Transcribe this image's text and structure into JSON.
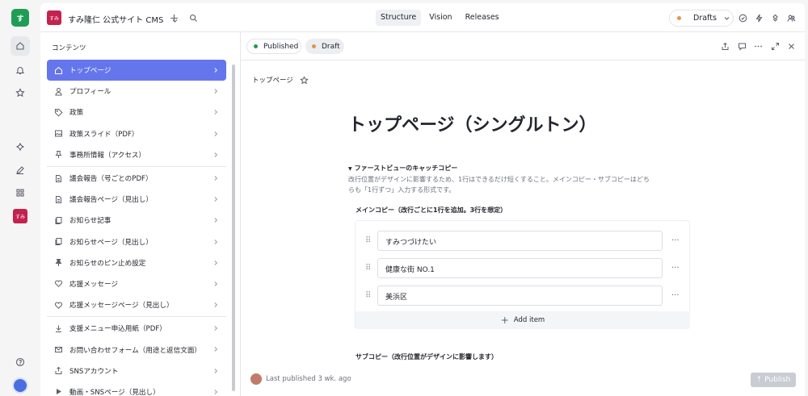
{
  "rail": {
    "logo_text": "す",
    "workspace_badge": "すみ"
  },
  "topbar": {
    "workspace_badge": "すみ",
    "workspace_title": "すみ隆仁 公式サイト CMS",
    "tabs": [
      {
        "label": "Structure"
      },
      {
        "label": "Vision"
      },
      {
        "label": "Releases"
      }
    ],
    "release_selector": "Drafts"
  },
  "sidebar": {
    "heading": "コンテンツ",
    "items": [
      {
        "label": "トップページ",
        "icon": "home-icon"
      },
      {
        "label": "プロフィール",
        "icon": "user-icon"
      },
      {
        "label": "政策",
        "icon": "tag-icon"
      },
      {
        "label": "政策スライド（PDF）",
        "icon": "image-icon"
      },
      {
        "label": "事務所情報（アクセス）",
        "icon": "pin-icon"
      },
      {
        "label": "議会報告（号ごとのPDF）",
        "icon": "doc-icon"
      },
      {
        "label": "議会報告ページ（見出し）",
        "icon": "doc-icon"
      },
      {
        "label": "お知らせ記事",
        "icon": "copy-icon"
      },
      {
        "label": "お知らせページ（見出し）",
        "icon": "copy-icon"
      },
      {
        "label": "お知らせのピン止め設定",
        "icon": "pin-icon"
      },
      {
        "label": "応援メッセージ",
        "icon": "heart-icon"
      },
      {
        "label": "応援メッセージページ（見出し）",
        "icon": "heart-icon"
      },
      {
        "label": "支援メニュー申込用紙（PDF）",
        "icon": "download-icon"
      },
      {
        "label": "お問い合わせフォーム（用途と返信文面）",
        "icon": "mail-icon"
      },
      {
        "label": "SNSアカウント",
        "icon": "share-icon"
      },
      {
        "label": "動画・SNSページ（見出し）",
        "icon": "play-icon"
      }
    ]
  },
  "main": {
    "status_published": "Published",
    "status_draft": "Draft",
    "breadcrumb": "トップページ",
    "doc_title": "トップページ（シングルトン）",
    "field_label": "ファーストビューのキャッチコピー",
    "field_desc": "改行位置がデザインに影響するため、1行はできるだけ短くすること。メインコピー・サブコピーはどちらも「1行ずつ」入力する形式です。",
    "main_copy_label": "メインコピー（改行ごとに1行を追加。3行を想定）",
    "main_copy_items": [
      "すみつづけたい",
      "健康な街 NO.1",
      "美浜区"
    ],
    "add_item": "Add item",
    "sub_copy_label": "サブコピー（改行位置がデザインに影響します）",
    "last_published": "Last published 3 wk. ago",
    "publish_button": "Publish"
  },
  "colors": {
    "accent": "#6576ec",
    "published_dot": "#1f9d55",
    "draft_dot": "#e8944a",
    "workspace": "#c4224e"
  }
}
